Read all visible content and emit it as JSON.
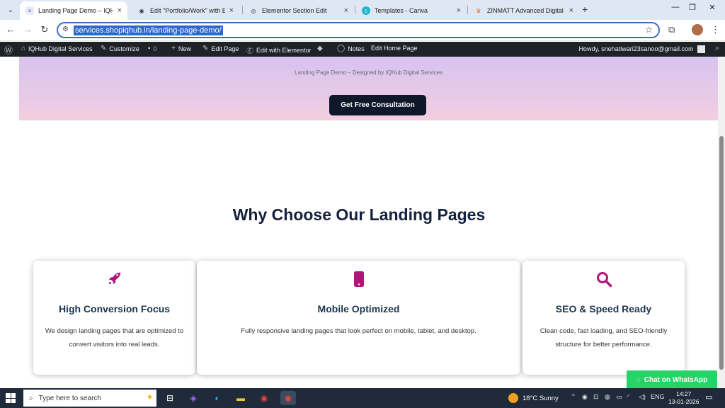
{
  "browser": {
    "tabs": [
      {
        "title": "Landing Page Demo – IQHub D",
        "active": true
      },
      {
        "title": "Edit \"Portfolio/Work\" with Elem",
        "active": false
      },
      {
        "title": "Elementor Section Edit",
        "active": false
      },
      {
        "title": "Templates - Canva",
        "active": false
      },
      {
        "title": "ZINMATT Advanced Digital Mar",
        "active": false
      }
    ],
    "url": "services.shopiqhub.in/landing-page-demo/"
  },
  "wp_admin_bar": {
    "site_name": "IQHub Digital Services",
    "customize": "Customize",
    "comments_count": "0",
    "new": "New",
    "edit_page": "Edit Page",
    "edit_with_elementor": "Edit with Elementor",
    "notes": "Notes",
    "edit_home_page": "Edit Home Page",
    "greeting": "Howdy, snehatiwari23sanoo@gmail.com"
  },
  "hero": {
    "subtitle": "Landing Page Demo – Designed by IQHub Digital Services",
    "cta_label": "Get Free Consultation"
  },
  "features": {
    "title": "Why Choose Our Landing Pages",
    "icon_color": "#b5127a",
    "cards": [
      {
        "icon": "rocket-icon",
        "heading": "High Conversion Focus",
        "text": "We design landing pages that are optimized to convert visitors into real leads."
      },
      {
        "icon": "mobile-icon",
        "heading": "Mobile Optimized",
        "text": "Fully responsive landing pages that look perfect on mobile, tablet, and desktop."
      },
      {
        "icon": "search-icon",
        "heading": "SEO & Speed Ready",
        "text": "Clean code, fast loading, and SEO-friendly structure for better performance."
      }
    ]
  },
  "whatsapp": {
    "label": "Chat on WhatsApp"
  },
  "taskbar": {
    "search_placeholder": "Type here to search",
    "weather": "18°C  Sunny",
    "language": "ENG",
    "time": "14:27",
    "date": "13-01-2026"
  }
}
